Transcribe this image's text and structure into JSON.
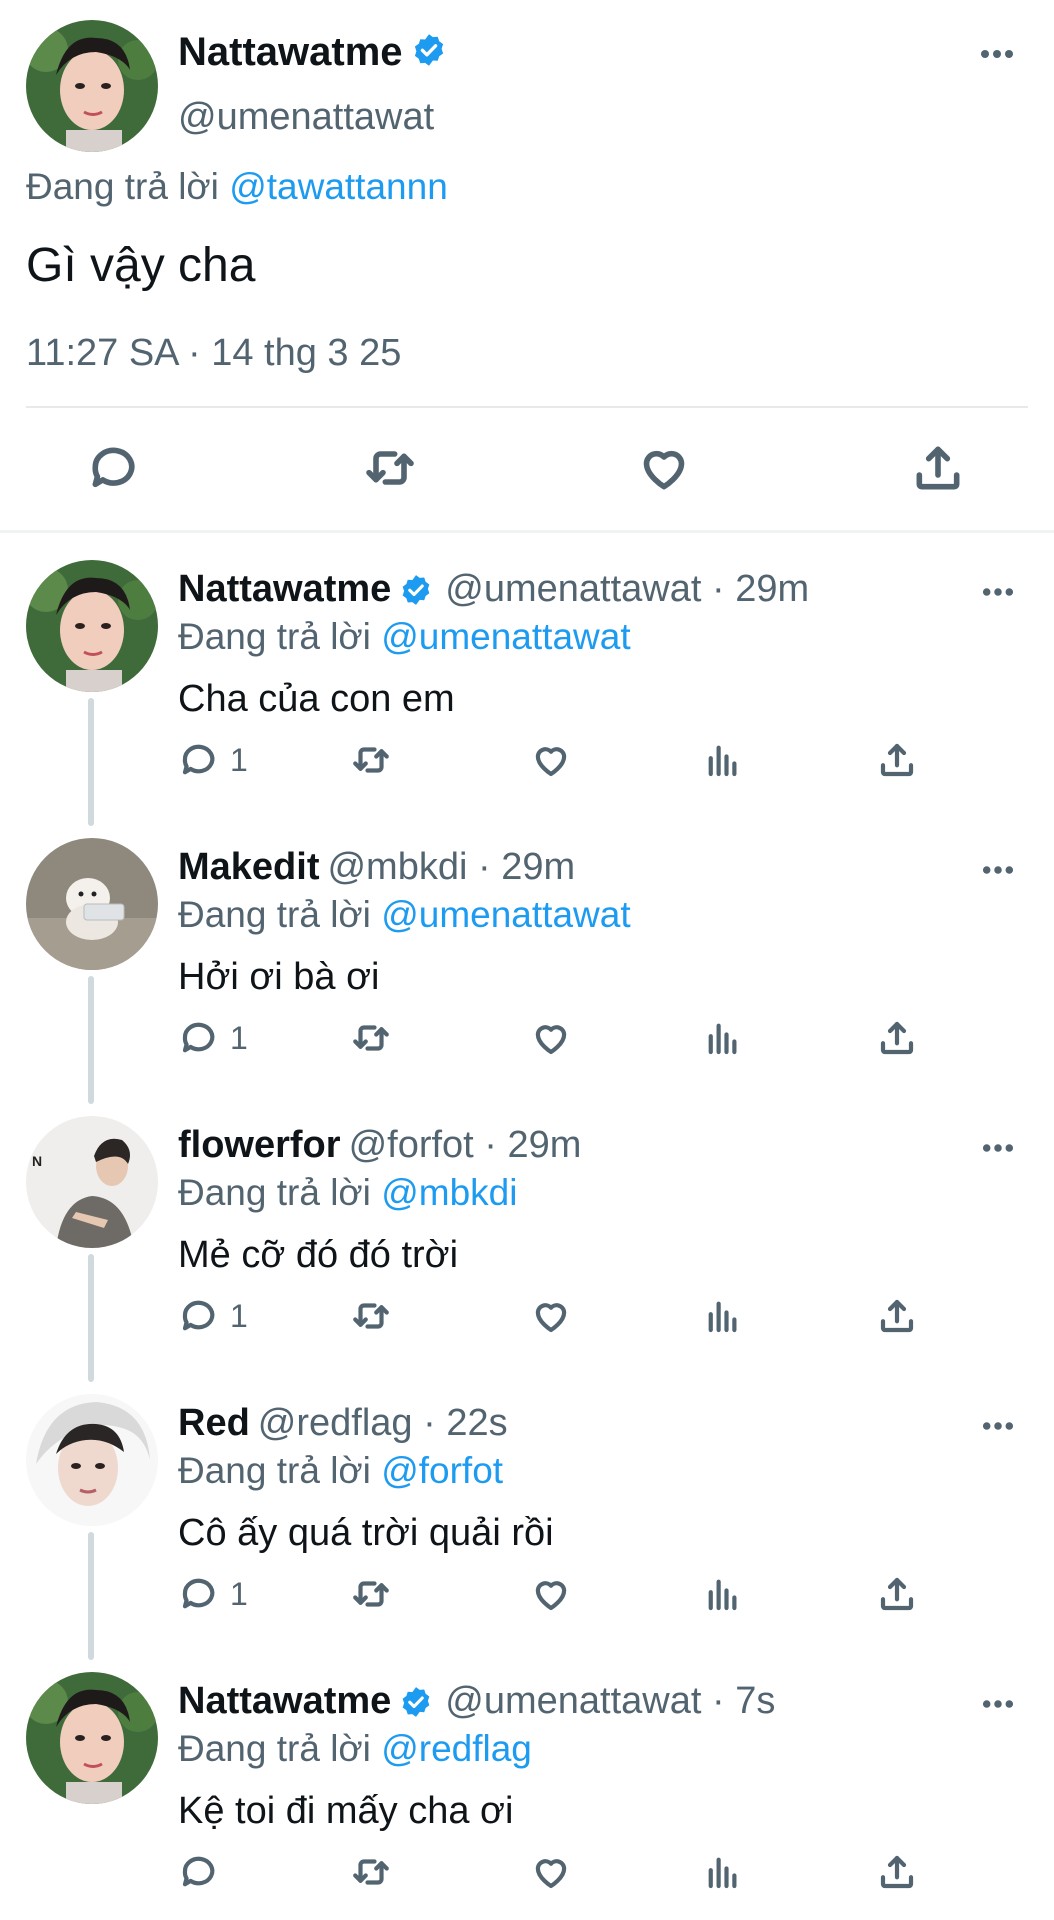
{
  "colors": {
    "accent": "#1d9bf0",
    "text": "#0f1419",
    "muted": "#536471",
    "divider": "#eff3f4"
  },
  "main_tweet": {
    "name": "Nattawatme",
    "verified": true,
    "handle": "@umenattawat",
    "replying_prefix": "Đang trả lời",
    "replying_to": "@tawattannn",
    "text": "Gì vậy cha",
    "timestamp": "11:27 SA · 14 thg 3 25",
    "actions": [
      "reply-icon",
      "retweet-icon",
      "like-icon",
      "share-icon"
    ]
  },
  "replies": [
    {
      "name": "Nattawatme",
      "verified": true,
      "meta": "@umenattawat · 29m",
      "replying_prefix": "Đang trả lời",
      "replying_to": "@umenattawat",
      "text": "Cha của con em",
      "reply_count": "1",
      "avatar": "nattawat"
    },
    {
      "name": "Makedit",
      "verified": false,
      "meta": "@mbkdi · 29m",
      "replying_prefix": "Đang trả lời",
      "replying_to": "@umenattawat",
      "text": "Hởi ơi bà ơi",
      "reply_count": "1",
      "avatar": "dog"
    },
    {
      "name": "flowerfor",
      "verified": false,
      "meta": "@forfot · 29m",
      "replying_prefix": "Đang trả lời",
      "replying_to": "@mbkdi",
      "text": "Mẻ cỡ đó đó trời",
      "reply_count": "1",
      "avatar": "man"
    },
    {
      "name": "Red",
      "verified": false,
      "meta": "@redflag · 22s",
      "replying_prefix": "Đang trả lời",
      "replying_to": "@forfot",
      "text": "Cô ấy quá trời quải rồi",
      "reply_count": "1",
      "avatar": "red"
    },
    {
      "name": "Nattawatme",
      "verified": true,
      "meta": "@umenattawat · 7s",
      "replying_prefix": "Đang trả lời",
      "replying_to": "@redflag",
      "text": "Kệ toi đi mấy cha ơi",
      "reply_count": "",
      "avatar": "nattawat"
    }
  ]
}
